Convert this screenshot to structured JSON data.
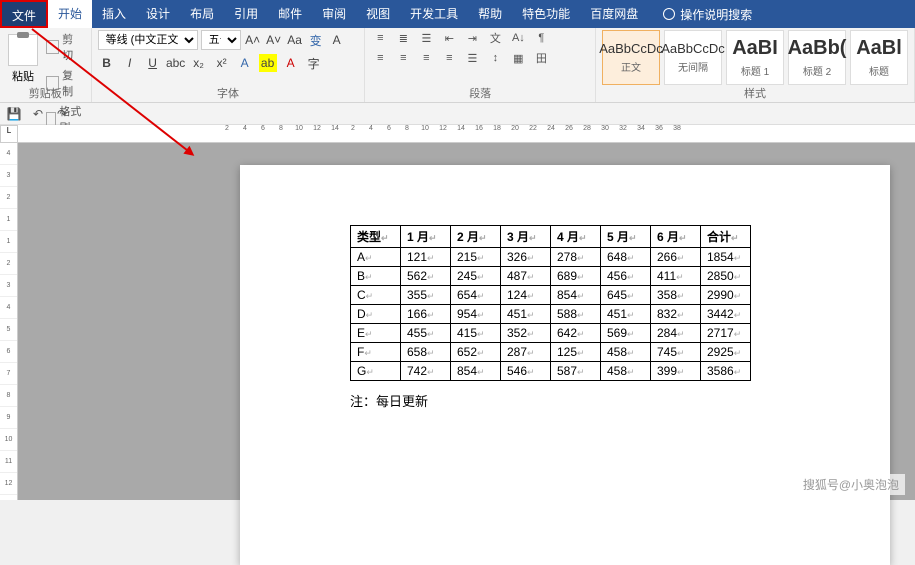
{
  "tabs": {
    "file": "文件",
    "home": "开始",
    "insert": "插入",
    "design": "设计",
    "layout": "布局",
    "ref": "引用",
    "mail": "邮件",
    "review": "审阅",
    "view": "视图",
    "dev": "开发工具",
    "help": "帮助",
    "special": "特色功能",
    "baidu": "百度网盘",
    "search": "操作说明搜索"
  },
  "clipboard": {
    "paste": "粘贴",
    "cut": "剪切",
    "copy": "复制",
    "fmtpainter": "格式刷",
    "label": "剪贴板"
  },
  "font": {
    "name": "等线 (中文正文)",
    "size": "五号",
    "label": "字体"
  },
  "paragraph": {
    "label": "段落"
  },
  "styles": {
    "label": "样式",
    "items": [
      {
        "preview": "AaBbCcDc",
        "name": "正文"
      },
      {
        "preview": "AaBbCcDc",
        "name": "无间隔"
      },
      {
        "preview": "AaBI",
        "name": "标题 1"
      },
      {
        "preview": "AaBb(",
        "name": "标题 2"
      },
      {
        "preview": "AaBl",
        "name": "标题"
      }
    ]
  },
  "doc": {
    "headers": [
      "类型",
      "1 月",
      "2 月",
      "3 月",
      "4 月",
      "5 月",
      "6 月",
      "合计"
    ],
    "rows": [
      [
        "A",
        "121",
        "215",
        "326",
        "278",
        "648",
        "266",
        "1854"
      ],
      [
        "B",
        "562",
        "245",
        "487",
        "689",
        "456",
        "411",
        "2850"
      ],
      [
        "C",
        "355",
        "654",
        "124",
        "854",
        "645",
        "358",
        "2990"
      ],
      [
        "D",
        "166",
        "954",
        "451",
        "588",
        "451",
        "832",
        "3442"
      ],
      [
        "E",
        "455",
        "415",
        "352",
        "642",
        "569",
        "284",
        "2717"
      ],
      [
        "F",
        "658",
        "652",
        "287",
        "125",
        "458",
        "745",
        "2925"
      ],
      [
        "G",
        "742",
        "854",
        "546",
        "587",
        "458",
        "399",
        "3586"
      ]
    ],
    "note": "注：每日更新"
  },
  "ruler_h": [
    2,
    4,
    6,
    8,
    10,
    12,
    14,
    2,
    4,
    6,
    8,
    10,
    12,
    14,
    16,
    18,
    20,
    22,
    24,
    26,
    28,
    30,
    32,
    34,
    36,
    38
  ],
  "ruler_v": [
    4,
    3,
    2,
    1,
    1,
    2,
    3,
    4,
    5,
    6,
    7,
    8,
    9,
    10,
    11,
    12
  ],
  "watermark": "搜狐号@小奥泡泡"
}
